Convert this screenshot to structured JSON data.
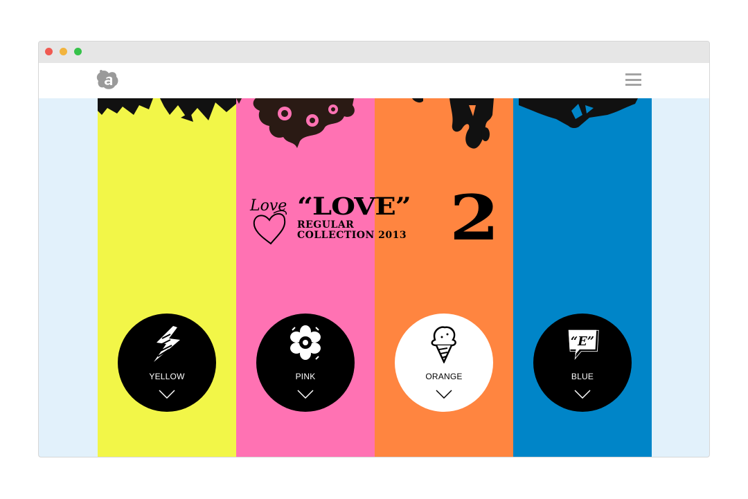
{
  "browser": {
    "controls": [
      "close",
      "minimize",
      "maximize"
    ]
  },
  "header": {
    "logo_icon": "a-splash-logo-icon",
    "menu_icon": "hamburger-icon"
  },
  "headline": {
    "script_text": "Love",
    "title": "“LOVE”",
    "subtitle_line1": "REGULAR",
    "subtitle_line2": "COLLECTION 2013",
    "number": "2"
  },
  "columns": [
    {
      "label": "YELLOW",
      "color": "#f2f648",
      "icon": "lightning-icon",
      "active": false
    },
    {
      "label": "PINK",
      "color": "#ff72b3",
      "icon": "flower-icon",
      "active": false
    },
    {
      "label": "ORANGE",
      "color": "#ff8540",
      "icon": "ice-cream-icon",
      "active": true
    },
    {
      "label": "BLUE",
      "color": "#0085c8",
      "icon": "speech-bubble-e-icon",
      "active": false
    }
  ]
}
